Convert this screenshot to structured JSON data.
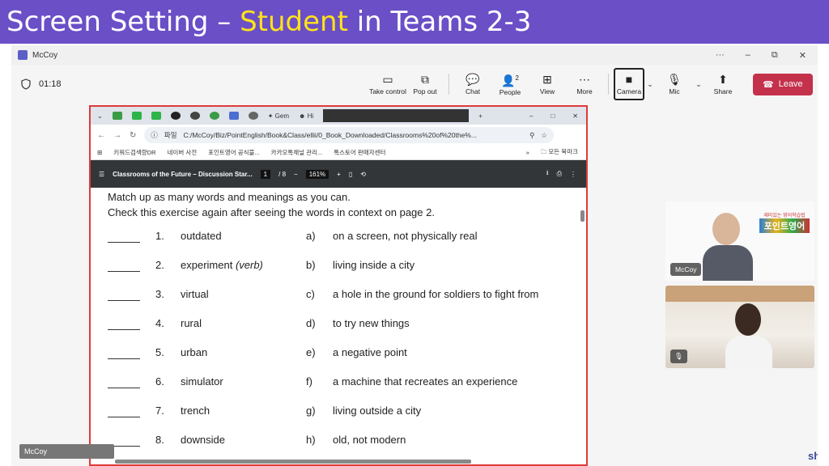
{
  "banner": {
    "prefix": "Screen Setting – ",
    "highlight": "Student",
    "suffix": " in Teams 2-3"
  },
  "window": {
    "title": "McCoy",
    "controls": [
      "···",
      "–",
      "⧉",
      "✕"
    ]
  },
  "meeting": {
    "timer": "01:18"
  },
  "toolbar": {
    "take_control": "Take control",
    "pop_out": "Pop out",
    "chat": "Chat",
    "people": "People",
    "people_count": "2",
    "view": "View",
    "more": "More",
    "camera": "Camera",
    "mic": "Mic",
    "share": "Share",
    "leave": "Leave"
  },
  "browser": {
    "tab_title": "Gem",
    "tab_title2": "Hi",
    "file_label": "파일",
    "url": "C:/McCoy/Biz/PointEnglish/Book&Class/ellii/0_Book_Downloaded/Classrooms%20of%20the%...",
    "bookmarks": [
      "키워드검색량DR",
      "네이버 사전",
      "포인트영어 공식블...",
      "카카오톡채널 관리...",
      "톡스토어 판매자센터"
    ],
    "bookmarks_more": "»",
    "bookmarks_folder": "모든 북마크"
  },
  "pdf": {
    "title": "Classrooms of the Future – Discussion Star...",
    "page_current": "1",
    "page_total": "/  8",
    "zoom": "161%",
    "instruction1": "Match up as many words and meanings as you can.",
    "instruction2": "Check this exercise again after seeing the words in context on page 2.",
    "items": [
      {
        "num": "1.",
        "word": "outdated",
        "letter": "a)",
        "meaning": "on a screen, not physically real"
      },
      {
        "num": "2.",
        "word": "experiment",
        "word_note": "(verb)",
        "letter": "b)",
        "meaning": "living inside a city"
      },
      {
        "num": "3.",
        "word": "virtual",
        "letter": "c)",
        "meaning": "a hole in the ground for soldiers to fight from"
      },
      {
        "num": "4.",
        "word": "rural",
        "letter": "d)",
        "meaning": "to try new things"
      },
      {
        "num": "5.",
        "word": "urban",
        "letter": "e)",
        "meaning": "a negative point"
      },
      {
        "num": "6.",
        "word": "simulator",
        "letter": "f)",
        "meaning": "a machine that recreates an experience"
      },
      {
        "num": "7.",
        "word": "trench",
        "letter": "g)",
        "meaning": "living outside a city"
      },
      {
        "num": "8.",
        "word": "downside",
        "letter": "h)",
        "meaning": "old, not modern"
      }
    ]
  },
  "participants": {
    "tile1_name": "McCoy",
    "logo_top": "재미있는 영어학습법",
    "logo_main": "포인트영어",
    "local_name": "McCoy",
    "edge_text": "sh"
  },
  "colors": {
    "banner": "#6a4fc7",
    "highlight": "#ffe21a",
    "leave": "#c4314b",
    "share_border": "#e03a3a"
  }
}
